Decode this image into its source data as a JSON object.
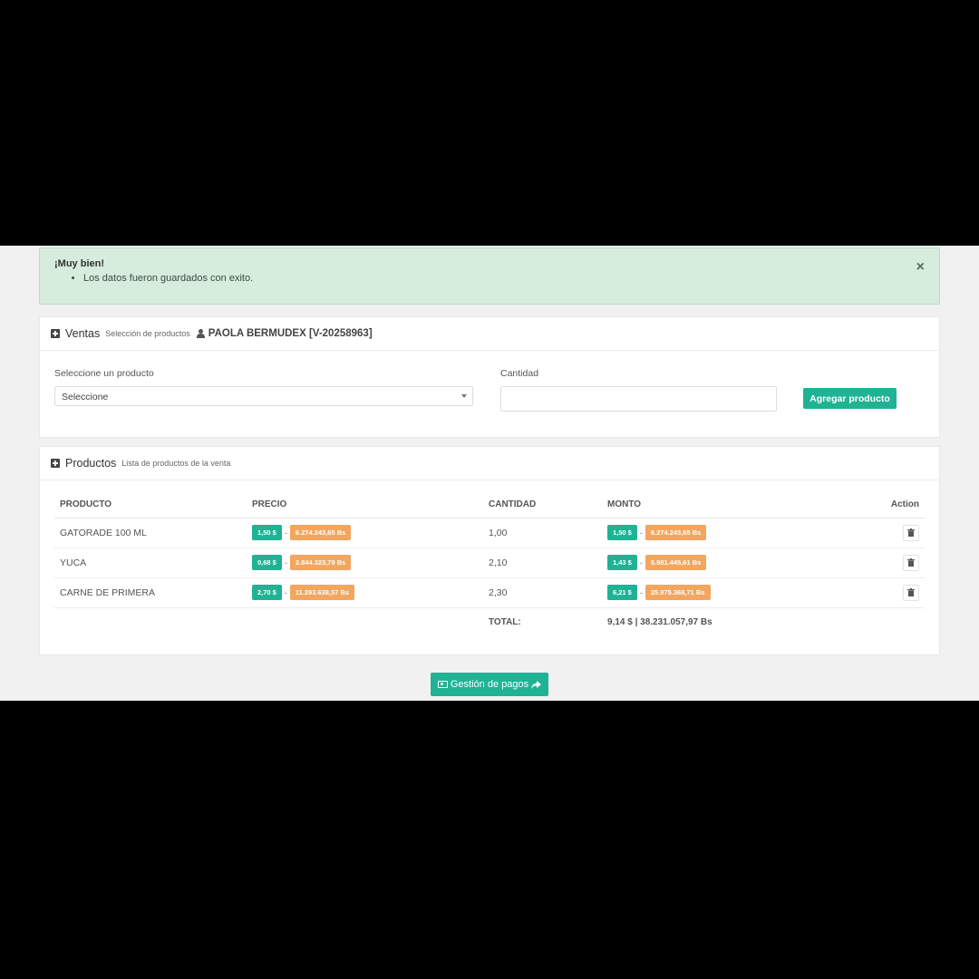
{
  "alert": {
    "title": "¡Muy bien!",
    "message": "Los datos fueron guardados con exito.",
    "close": "×"
  },
  "ventas": {
    "title": "Ventas",
    "subtitle": "Selección de productos",
    "client": "PAOLA BERMUDEX [V-20258963]",
    "product_label": "Seleccione un producto",
    "product_selected": "Seleccione",
    "qty_label": "Cantidad",
    "qty_value": "",
    "add_button": "Agregar producto"
  },
  "productos": {
    "title": "Productos",
    "subtitle": "Lista de productos de la venta",
    "headers": {
      "producto": "PRODUCTO",
      "precio": "PRECIO",
      "cantidad": "CANTIDAD",
      "monto": "MONTO",
      "action": "Action"
    },
    "rows": [
      {
        "producto": "GATORADE 100 ML",
        "precio_usd": "1,50 $",
        "precio_bs": "6.274.243,65 Bs",
        "cantidad": "1,00",
        "monto_usd": "1,50 $",
        "monto_bs": "6.274.243,65 Bs"
      },
      {
        "producto": "YUCA",
        "precio_usd": "0,68 $",
        "precio_bs": "2.844.323,79 Bs",
        "cantidad": "2,10",
        "monto_usd": "1,43 $",
        "monto_bs": "5.981.445,61 Bs"
      },
      {
        "producto": "CARNE DE PRIMERA",
        "precio_usd": "2,70 $",
        "precio_bs": "11.293.638,57 Bs",
        "cantidad": "2,30",
        "monto_usd": "6,21 $",
        "monto_bs": "25.975.368,71 Bs"
      }
    ],
    "total_label": "TOTAL:",
    "total_value": "9,14 $ | 38.231.057,97 Bs",
    "separator": "-"
  },
  "payments_button": "Gestión de pagos",
  "colors": {
    "accent": "#1fb394",
    "orange": "#f3a65f",
    "alert_bg": "#d6ecdc"
  }
}
